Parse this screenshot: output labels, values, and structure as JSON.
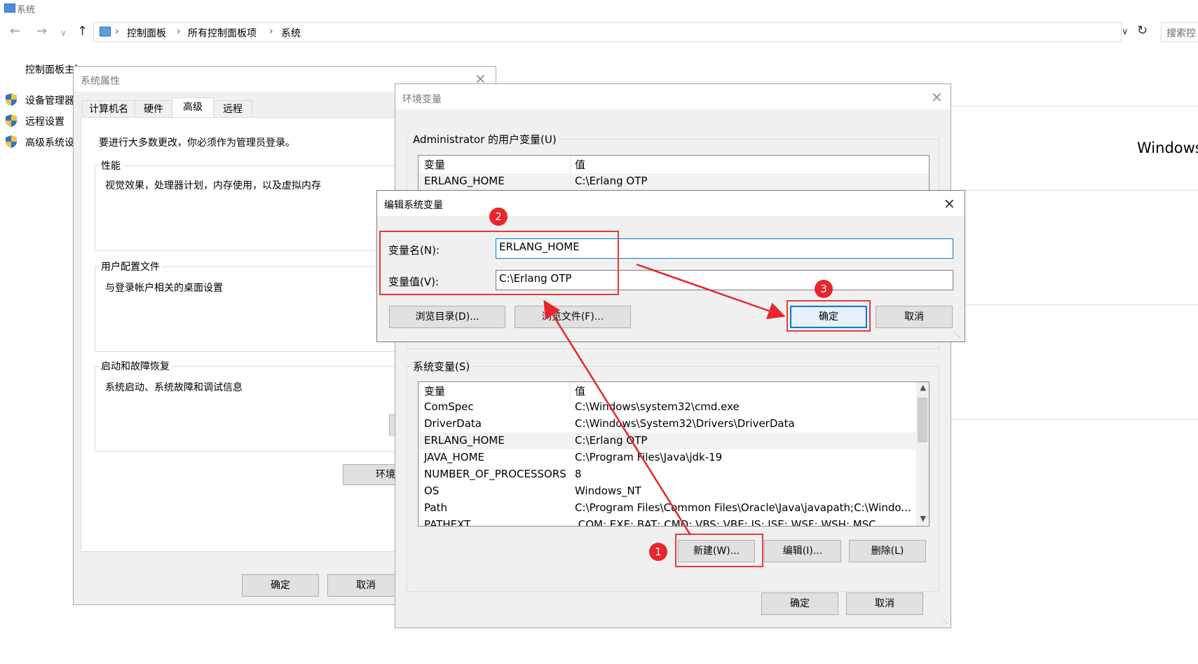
{
  "window": {
    "title": "系统",
    "breadcrumb": [
      "控制面板",
      "所有控制面板项",
      "系统"
    ],
    "search_placeholder": "搜索控",
    "sidebar": {
      "home": "控制面板主页",
      "items": [
        "设备管理器",
        "远程设置",
        "高级系统设置"
      ]
    },
    "windows_text": "Windows"
  },
  "sys_props": {
    "title": "系统属性",
    "tabs": [
      "计算机名",
      "硬件",
      "高级",
      "远程"
    ],
    "admin_note": "要进行大多数更改，你必须作为管理员登录。",
    "groups": [
      {
        "label": "性能",
        "desc": "视觉效果，处理器计划，内存使用，以及虚拟内存"
      },
      {
        "label": "用户配置文件",
        "desc": "与登录帐户相关的桌面设置"
      },
      {
        "label": "启动和故障恢复",
        "desc": "系统启动、系统故障和调试信息"
      }
    ],
    "env_button": "环境",
    "ok": "确定",
    "cancel": "取消"
  },
  "env_vars": {
    "title": "环境变量",
    "user_label": "Administrator 的用户变量(U)",
    "user_headers": [
      "变量",
      "值"
    ],
    "user_rows": [
      {
        "name": "ERLANG_HOME",
        "value": "C:\\Erlang OTP"
      }
    ],
    "sys_label": "系统变量(S)",
    "sys_headers": [
      "变量",
      "值"
    ],
    "sys_rows": [
      {
        "name": "ComSpec",
        "value": "C:\\Windows\\system32\\cmd.exe"
      },
      {
        "name": "DriverData",
        "value": "C:\\Windows\\System32\\Drivers\\DriverData"
      },
      {
        "name": "ERLANG_HOME",
        "value": "C:\\Erlang OTP"
      },
      {
        "name": "JAVA_HOME",
        "value": "C:\\Program Files\\Java\\jdk-19"
      },
      {
        "name": "NUMBER_OF_PROCESSORS",
        "value": "8"
      },
      {
        "name": "OS",
        "value": "Windows_NT"
      },
      {
        "name": "Path",
        "value": "C:\\Program Files\\Common Files\\Oracle\\Java\\javapath;C:\\Windo..."
      },
      {
        "name": "PATHEXT",
        "value": ".COM;.EXE;.BAT;.CMD;.VBS;.VBE;.JS;.JSE;.WSF;.WSH;.MSC"
      }
    ],
    "new_button": "新建(W)...",
    "edit_button": "编辑(I)...",
    "delete_button": "删除(L)",
    "ok": "确定",
    "cancel": "取消"
  },
  "edit_dialog": {
    "title": "编辑系统变量",
    "name_label": "变量名(N):",
    "name_value": "ERLANG_HOME",
    "value_label": "变量值(V):",
    "value_value": "C:\\Erlang OTP",
    "browse_dir": "浏览目录(D)...",
    "browse_file": "浏览文件(F)...",
    "ok": "确定",
    "cancel": "取消"
  },
  "annotations": {
    "badges": [
      "1",
      "2",
      "3"
    ],
    "color": "#e8262b"
  }
}
